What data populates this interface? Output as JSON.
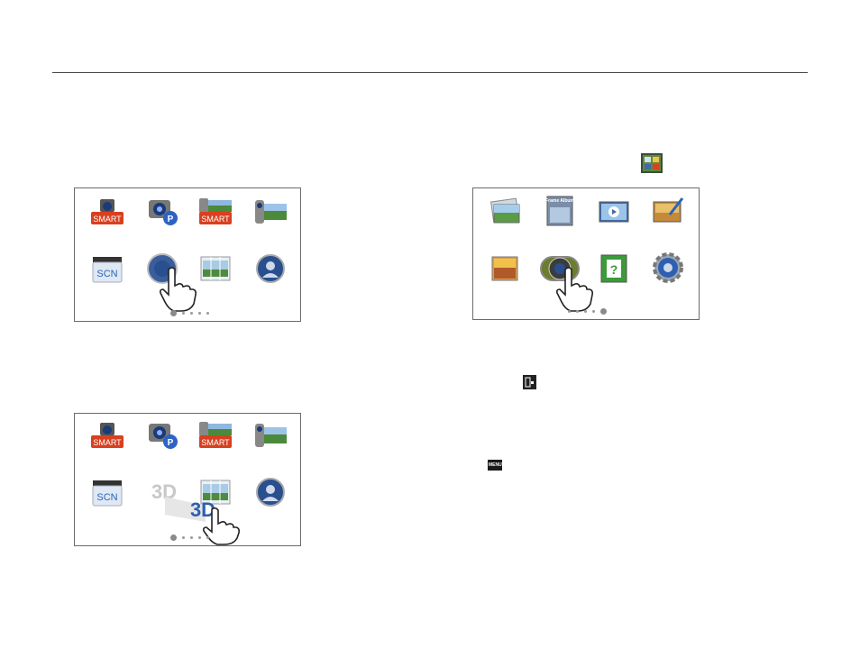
{
  "screens": {
    "top_left": {
      "icons": [
        {
          "name": "smart-auto-icon",
          "label": "SMART"
        },
        {
          "name": "program-icon",
          "label": "P"
        },
        {
          "name": "smart-movie-icon",
          "label": "SMART"
        },
        {
          "name": "movie-icon",
          "label": ""
        },
        {
          "name": "scene-icon",
          "label": "SCN"
        },
        {
          "name": "3d-photo-icon",
          "label": ""
        },
        {
          "name": "panorama-icon",
          "label": ""
        },
        {
          "name": "beauty-shot-icon",
          "label": ""
        }
      ]
    },
    "bottom_left": {
      "icons": [
        {
          "name": "smart-auto-icon",
          "label": "SMART"
        },
        {
          "name": "program-icon",
          "label": "P"
        },
        {
          "name": "smart-movie-icon",
          "label": "SMART"
        },
        {
          "name": "movie-icon",
          "label": ""
        },
        {
          "name": "scene-icon",
          "label": "SCN"
        },
        {
          "name": "3d-ghost-icon",
          "label": "3D"
        },
        {
          "name": "panorama-icon",
          "label": ""
        },
        {
          "name": "beauty-shot-icon",
          "label": ""
        }
      ],
      "drag_label": "3D"
    },
    "top_right": {
      "icons": [
        {
          "name": "album-icon",
          "label": ""
        },
        {
          "name": "frame-album-icon",
          "label": "Frame Album"
        },
        {
          "name": "slide-show-icon",
          "label": ""
        },
        {
          "name": "photo-editor-icon",
          "label": ""
        },
        {
          "name": "scene-editor-icon",
          "label": ""
        },
        {
          "name": "camera-mode-icon",
          "label": ""
        },
        {
          "name": "help-guide-icon",
          "label": "?"
        },
        {
          "name": "settings-icon",
          "label": ""
        }
      ]
    }
  },
  "inline_icons": {
    "mode_icon": "mode-icon",
    "display_icon": "display-icon",
    "menu_button": "MENU"
  }
}
